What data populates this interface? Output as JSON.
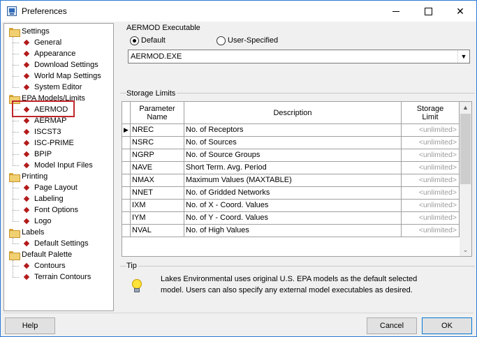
{
  "window": {
    "title": "Preferences"
  },
  "tree": [
    {
      "label": "Settings",
      "type": "folder",
      "name": "settings",
      "children": [
        {
          "label": "General",
          "name": "general"
        },
        {
          "label": "Appearance",
          "name": "appearance"
        },
        {
          "label": "Download Settings",
          "name": "download-settings"
        },
        {
          "label": "World Map Settings",
          "name": "world-map-settings"
        },
        {
          "label": "System Editor",
          "name": "system-editor"
        }
      ]
    },
    {
      "label": "EPA Models/Limits",
      "type": "folder",
      "name": "epa-models-limits",
      "children": [
        {
          "label": "AERMOD",
          "name": "aermod",
          "selected": true
        },
        {
          "label": "AERMAP",
          "name": "aermap"
        },
        {
          "label": "ISCST3",
          "name": "iscst3"
        },
        {
          "label": "ISC-PRIME",
          "name": "isc-prime"
        },
        {
          "label": "BPIP",
          "name": "bpip"
        },
        {
          "label": "Model Input Files",
          "name": "model-input-files"
        }
      ]
    },
    {
      "label": "Printing",
      "type": "folder",
      "name": "printing",
      "children": [
        {
          "label": "Page Layout",
          "name": "page-layout"
        },
        {
          "label": "Labeling",
          "name": "labeling"
        },
        {
          "label": "Font Options",
          "name": "font-options"
        },
        {
          "label": "Logo",
          "name": "logo"
        }
      ]
    },
    {
      "label": "Labels",
      "type": "folder",
      "name": "labels",
      "children": [
        {
          "label": "Default Settings",
          "name": "default-settings"
        }
      ]
    },
    {
      "label": "Default Palette",
      "type": "folder",
      "name": "default-palette",
      "children": [
        {
          "label": "Contours",
          "name": "contours"
        },
        {
          "label": "Terrain Contours",
          "name": "terrain-contours"
        }
      ]
    }
  ],
  "executable": {
    "group_label": "AERMOD Executable",
    "option_default": "Default",
    "option_user": "User-Specified",
    "selected": "Default",
    "combo_value": "AERMOD.EXE"
  },
  "storage": {
    "group_label": "Storage Limits",
    "headers": {
      "param": "Parameter\nName",
      "desc": "Description",
      "limit": "Storage\nLimit"
    },
    "rows": [
      {
        "param": "NREC",
        "desc": "No. of Receptors",
        "limit": "<unlimited>",
        "current": true
      },
      {
        "param": "NSRC",
        "desc": "No. of Sources",
        "limit": "<unlimited>"
      },
      {
        "param": "NGRP",
        "desc": "No. of Source Groups",
        "limit": "<unlimited>"
      },
      {
        "param": "NAVE",
        "desc": "Short Term. Avg. Period",
        "limit": "<unlimited>"
      },
      {
        "param": "NMAX",
        "desc": "Maximum Values (MAXTABLE)",
        "limit": "<unlimited>"
      },
      {
        "param": "NNET",
        "desc": "No. of Gridded Networks",
        "limit": "<unlimited>"
      },
      {
        "param": "IXM",
        "desc": "No. of X - Coord. Values",
        "limit": "<unlimited>"
      },
      {
        "param": "IYM",
        "desc": "No. of Y - Coord. Values",
        "limit": "<unlimited>"
      },
      {
        "param": "NVAL",
        "desc": "No. of High Values",
        "limit": "<unlimited>"
      }
    ]
  },
  "tip": {
    "group_label": "Tip",
    "icon": "lightbulb-icon",
    "line1": "Lakes Environmental uses original U.S. EPA models as the default selected",
    "line2": "model.  Users can also specify any external model executables as desired."
  },
  "buttons": {
    "help": "Help",
    "cancel": "Cancel",
    "ok": "OK"
  },
  "colors": {
    "selection_outline": "#c0262c",
    "accent": "#0078d7"
  }
}
